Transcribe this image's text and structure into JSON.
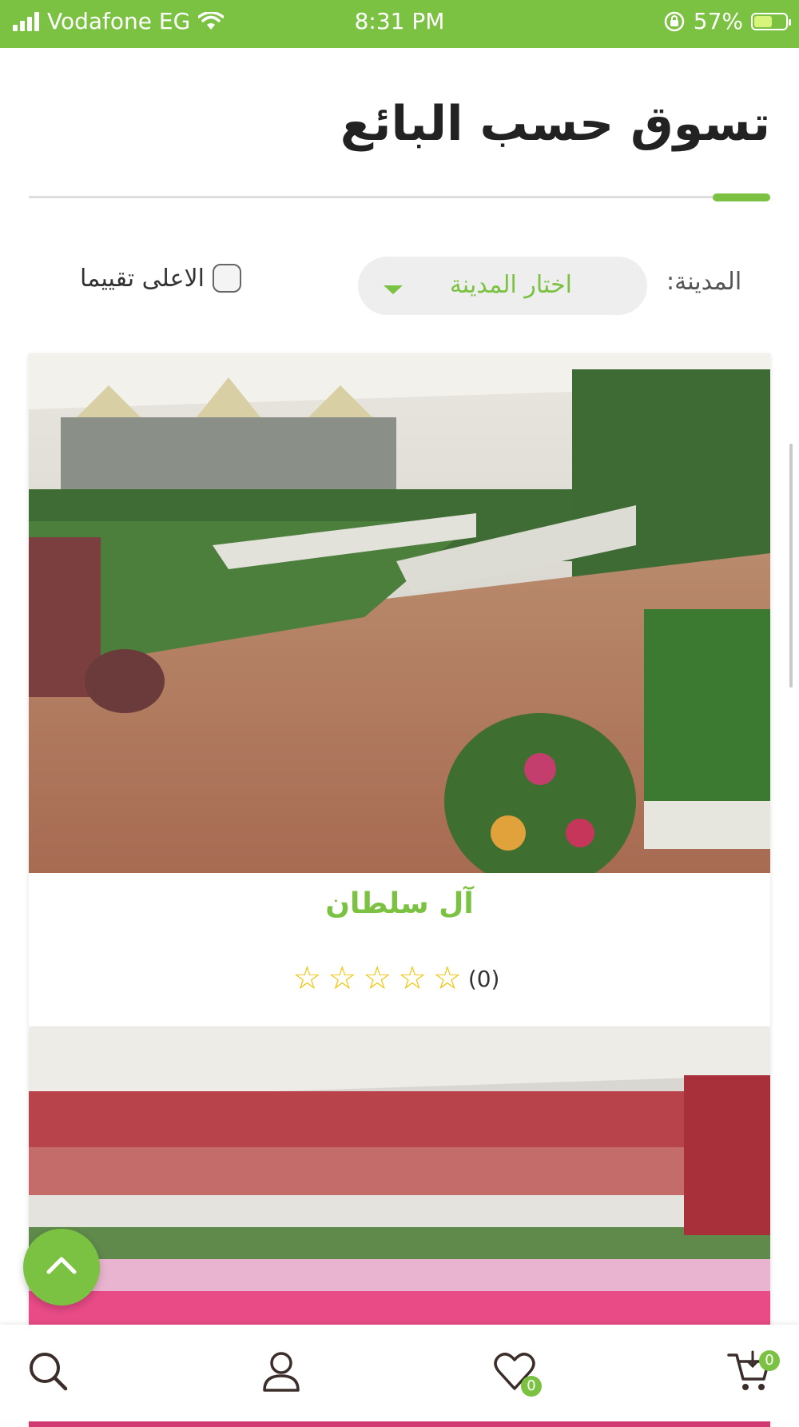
{
  "status_bar": {
    "carrier": "Vodafone EG",
    "time": "8:31 PM",
    "battery": "57%"
  },
  "page": {
    "title": "تسوق حسب البائع"
  },
  "filters": {
    "city_label": "المدينة:",
    "city_select_value": "اختار المدينة",
    "top_rated_label": "الاعلى تقييما",
    "top_rated_checked": false
  },
  "stores": [
    {
      "name": "آل سلطان",
      "rating_count": "(0)",
      "rating": 0,
      "max_rating": 5
    },
    {
      "name": "",
      "rating_count": "",
      "rating": 0,
      "max_rating": 5
    }
  ],
  "bottom_nav": {
    "wishlist_count": "0",
    "cart_count": "0"
  },
  "colors": {
    "accent": "#7cc242",
    "star": "#f2c200"
  },
  "icons": [
    "search-icon",
    "user-icon",
    "heart-icon",
    "cart-icon",
    "arrow-up-icon",
    "wifi-icon",
    "rotation-lock-icon",
    "battery-icon"
  ]
}
